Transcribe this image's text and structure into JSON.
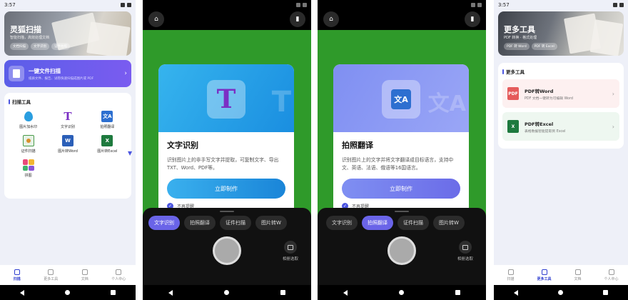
{
  "colors": {
    "accent": "#4b55e0",
    "camera_bg": "#2f9a2a",
    "active_mode": "#6a64e8"
  },
  "panel1": {
    "status_time": "3:57",
    "banner": {
      "title": "灵狐扫描",
      "subtitle": "智能扫描，高效处理文档",
      "chips": [
        "文档扫描",
        "文字识别",
        "证件拍照"
      ]
    },
    "oneclick": {
      "title": "一键文件扫描",
      "subtitle": "纸质文件、报告、试卷快速扫描成图片或 PDF"
    },
    "tools": {
      "title": "扫描工具",
      "items": [
        {
          "label": "图片加水印",
          "icon": "water-drop-icon"
        },
        {
          "label": "文字识别",
          "icon": "text-T-icon"
        },
        {
          "label": "拍照翻译",
          "icon": "translate-icon"
        },
        {
          "label": "证件扫描",
          "icon": "id-card-icon"
        },
        {
          "label": "图片转Word",
          "icon": "word-icon"
        },
        {
          "label": "图片转Excel",
          "icon": "excel-icon"
        },
        {
          "label": "拼图",
          "icon": "puzzle-icon"
        }
      ]
    },
    "nav": [
      {
        "label": "扫描",
        "active": true
      },
      {
        "label": "更多工具",
        "active": false
      },
      {
        "label": "文档",
        "active": false
      },
      {
        "label": "个人中心",
        "active": false
      }
    ]
  },
  "panel2": {
    "dialog": {
      "title": "文字识别",
      "desc": "识别图片上的非手写文字并提取，可复制文字、导出TXT、Word、PDF等。",
      "button": "立即制作",
      "check": "不再提醒"
    },
    "modes": [
      "文字识别",
      "拍照翻译",
      "证件扫描",
      "图片转W"
    ],
    "active_mode": 0,
    "album": "相册选取"
  },
  "panel3": {
    "dialog": {
      "title": "拍照翻译",
      "desc": "识别图片上的文字并将文字翻译成目标语言，支持中文、英语、法语、俄语等16国语言。",
      "button": "立即制作",
      "check": "不再提醒"
    },
    "modes": [
      "文字识别",
      "拍照翻译",
      "证件扫描",
      "图片转W"
    ],
    "active_mode": 1,
    "album": "相册选取"
  },
  "panel4": {
    "status_time": "3:57",
    "banner": {
      "title": "更多工具",
      "subtitle": "PDF 转换 · 格式处理",
      "chips": [
        "PDF 转 Word",
        "PDF 转 Excel"
      ]
    },
    "section_title": "更多工具",
    "items": [
      {
        "title": "PDF转Word",
        "subtitle": "PDF 文档一键转为可编辑 Word"
      },
      {
        "title": "PDF转Excel",
        "subtitle": "表格数据智能提取到 Excel"
      }
    ],
    "nav": [
      {
        "label": "扫描",
        "active": false
      },
      {
        "label": "更多工具",
        "active": true
      },
      {
        "label": "文档",
        "active": false
      },
      {
        "label": "个人中心",
        "active": false
      }
    ]
  }
}
